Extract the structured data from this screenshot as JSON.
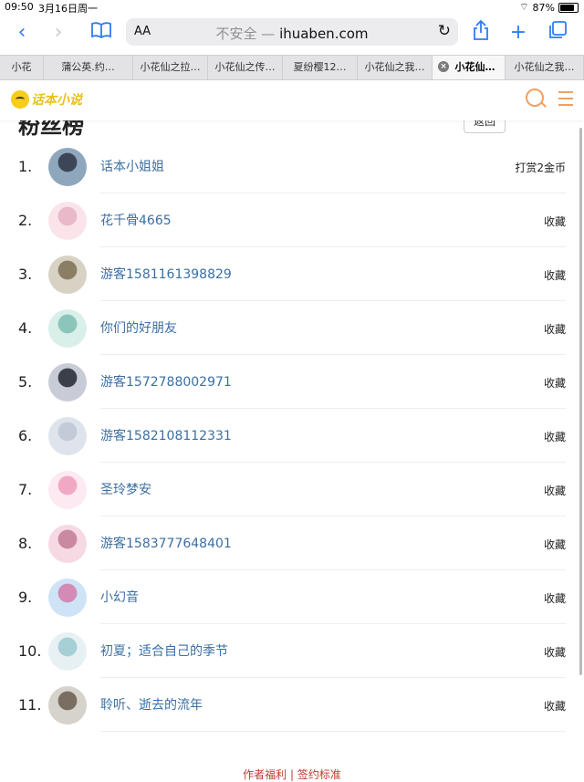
{
  "status": {
    "time": "09:50",
    "date": "3月16日周一",
    "battery": "87%"
  },
  "browser": {
    "aa": "AA",
    "insecure": "不安全 —",
    "domain": "ihuaben.com",
    "tabs": [
      "小花",
      "蒲公英.约…",
      "小花仙之拉…",
      "小花仙之传…",
      "夏纷樱12…",
      "小花仙之我…",
      "小花仙…",
      "小花仙之我…"
    ],
    "active_tab": 6
  },
  "site": {
    "logo": "话本小说"
  },
  "page": {
    "partial_title": "粉丝榜",
    "partial_btn": "返回"
  },
  "list": [
    {
      "rank": "1.",
      "name": "话本小姐姐",
      "action": "打赏2金币",
      "c1": "#8fa7bd",
      "c2": "#3c4656"
    },
    {
      "rank": "2.",
      "name": "花千骨4665",
      "action": "收藏",
      "c1": "#fbe3ea",
      "c2": "#e8b9c8"
    },
    {
      "rank": "3.",
      "name": "游客1581161398829",
      "action": "收藏",
      "c1": "#d7d2c4",
      "c2": "#8a7f64"
    },
    {
      "rank": "4.",
      "name": "你们的好朋友",
      "action": "收藏",
      "c1": "#d9efe9",
      "c2": "#8cc5b9"
    },
    {
      "rank": "5.",
      "name": "游客1572788002971",
      "action": "收藏",
      "c1": "#c8ccd6",
      "c2": "#3b3f4a"
    },
    {
      "rank": "6.",
      "name": "游客1582108112331",
      "action": "收藏",
      "c1": "#dfe4ec",
      "c2": "#c3cad8"
    },
    {
      "rank": "7.",
      "name": "圣玲梦安",
      "action": "收藏",
      "c1": "#fde9f1",
      "c2": "#f1a8c5"
    },
    {
      "rank": "8.",
      "name": "游客1583777648401",
      "action": "收藏",
      "c1": "#f6d9e3",
      "c2": "#c98aa1"
    },
    {
      "rank": "9.",
      "name": "小幻音",
      "action": "收藏",
      "c1": "#cfe3f6",
      "c2": "#d38bb6"
    },
    {
      "rank": "10.",
      "name": "初夏；适合自己的季节",
      "action": "收藏",
      "c1": "#e7f1f3",
      "c2": "#a6cfd6"
    },
    {
      "rank": "11.",
      "name": "聆听、逝去的流年",
      "action": "收藏",
      "c1": "#d6d2cc",
      "c2": "#7a6d62"
    }
  ],
  "footer": {
    "text": "作者福利 | 签约标准"
  }
}
